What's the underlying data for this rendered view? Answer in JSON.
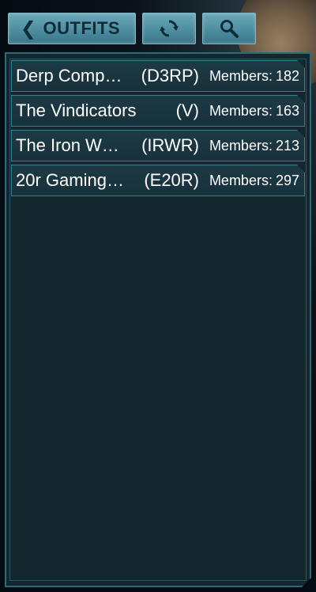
{
  "header": {
    "back_label": "OUTFITS",
    "back_icon": "chevron-left-icon",
    "refresh_icon": "refresh-icon",
    "search_icon": "search-icon"
  },
  "outfits": [
    {
      "name": "Derp Comp…",
      "tag": "(D3RP)",
      "members_label": "Members:",
      "members": "182"
    },
    {
      "name": "The Vindicators",
      "tag": "(V)",
      "members_label": "Members:",
      "members": "163"
    },
    {
      "name": "The Iron W…",
      "tag": "(IRWR)",
      "members_label": "Members:",
      "members": "213"
    },
    {
      "name": "20r Gaming…",
      "tag": "(E20R)",
      "members_label": "Members:",
      "members": "297"
    }
  ],
  "colors": {
    "accent": "#4d8ea0",
    "panel_bg": "#14272f",
    "row_border": "#3f7e8f",
    "text": "#ffffff"
  }
}
